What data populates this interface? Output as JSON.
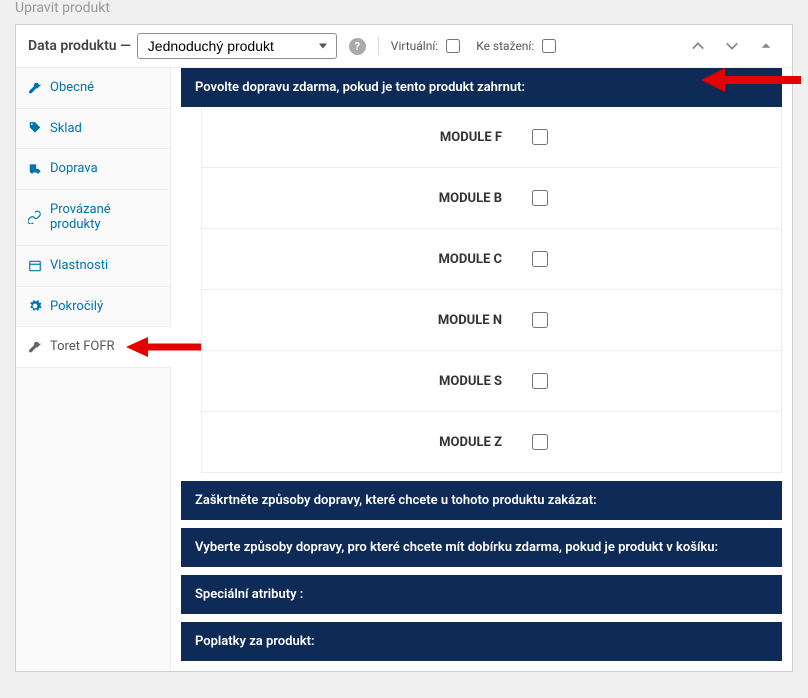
{
  "page_title_cropped": "Upravit produkt",
  "panel_header": {
    "title": "Data produktu —",
    "select_value": "Jednoduchý produkt",
    "virtual_label": "Virtuální:",
    "download_label": "Ke stažení:"
  },
  "tabs": [
    {
      "label": "Obecné",
      "icon": "wrench"
    },
    {
      "label": "Sklad",
      "icon": "tag"
    },
    {
      "label": "Doprava",
      "icon": "truck"
    },
    {
      "label": "Provázané produkty",
      "icon": "link"
    },
    {
      "label": "Vlastnosti",
      "icon": "panel"
    },
    {
      "label": "Pokročilý",
      "icon": "gear"
    },
    {
      "label": "Toret FOFR",
      "icon": "wrench"
    }
  ],
  "head_bars": {
    "free_ship": "Povolte dopravu zdarma, pokud je tento produkt zahrnut:",
    "disable_ship": "Zaškrtněte způsoby dopravy, které chcete u tohoto produktu zakázat:",
    "cod_free": "Vyberte způsoby dopravy, pro které chcete mít dobírku zdarma, pokud je produkt v košíku:",
    "attrs": "Speciální atributy :",
    "fees": "Poplatky za produkt:"
  },
  "modules": [
    "MODULE F",
    "MODULE B",
    "MODULE C",
    "MODULE N",
    "MODULE S",
    "MODULE Z"
  ]
}
